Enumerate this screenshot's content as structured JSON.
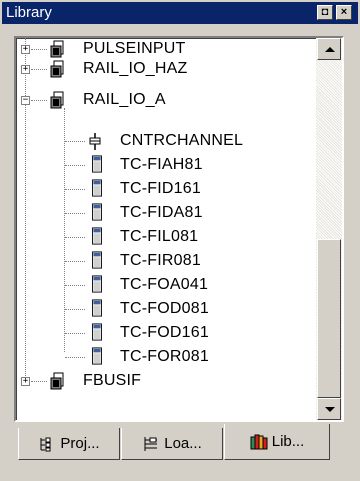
{
  "window": {
    "title": "Library",
    "float_button": "◘",
    "close_button": "×"
  },
  "tree": {
    "nodes": [
      {
        "label": "PULSEINPUT",
        "expander": "+"
      },
      {
        "label": "RAIL_IO_HAZ",
        "expander": "+"
      },
      {
        "label": "RAIL_IO_A",
        "expander": "−"
      },
      {
        "label": "CNTRCHANNEL"
      },
      {
        "label": "TC-FIAH81"
      },
      {
        "label": "TC-FID161"
      },
      {
        "label": "TC-FIDA81"
      },
      {
        "label": "TC-FIL081"
      },
      {
        "label": "TC-FIR081"
      },
      {
        "label": "TC-FOA041"
      },
      {
        "label": "TC-FOD081"
      },
      {
        "label": "TC-FOD161"
      },
      {
        "label": "TC-FOR081"
      },
      {
        "label": "FBUSIF",
        "expander": "+"
      }
    ]
  },
  "tabs": [
    {
      "label": "Proj...",
      "icon": "project-tree-icon"
    },
    {
      "label": "Loa...",
      "icon": "load-list-icon"
    },
    {
      "label": "Lib...",
      "icon": "library-books-icon",
      "active": true
    }
  ],
  "colors": {
    "titlebar": "#0a246a",
    "face": "#d4d0c8"
  }
}
